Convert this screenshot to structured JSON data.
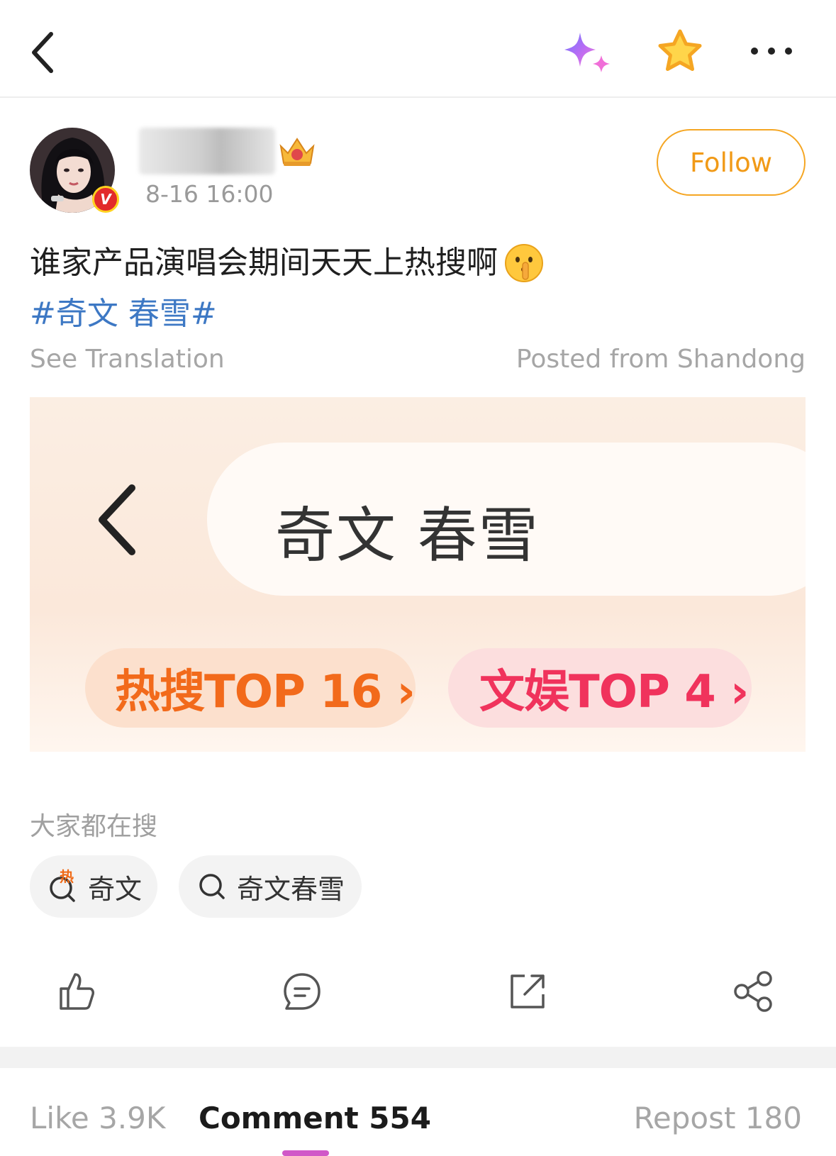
{
  "header": {
    "back_icon": "chevron-left-icon",
    "ai_icon": "sparkle-icon",
    "favorite_icon": "star-icon",
    "more_icon": "more-icon"
  },
  "author": {
    "post_time": "8-16 16:00",
    "follow_label": "Follow",
    "verified_badge": "V"
  },
  "post": {
    "text": "谁家产品演唱会期间天天上热搜啊",
    "emoji": "shushing-face-emoji",
    "hashtag": "#奇文 春雪#",
    "see_translation": "See Translation",
    "posted_from": "Posted from Shandong"
  },
  "image": {
    "search_text": "奇文 春雪",
    "pill_hot": "热搜TOP 16 ›",
    "pill_ent": "文娱TOP 4 ›"
  },
  "related": {
    "title": "大家都在搜",
    "chips": [
      "奇文",
      "奇文春雪"
    ],
    "hot_mark": "热"
  },
  "actions": [
    "like-icon",
    "comment-icon",
    "repost-icon",
    "share-icon"
  ],
  "tabs": {
    "like": "Like 3.9K",
    "comment": "Comment 554",
    "repost": "Repost 180"
  },
  "colors": {
    "accent": "#f19a17",
    "hashtag": "#3d78c4",
    "tab_indicator": "#d058c8"
  }
}
